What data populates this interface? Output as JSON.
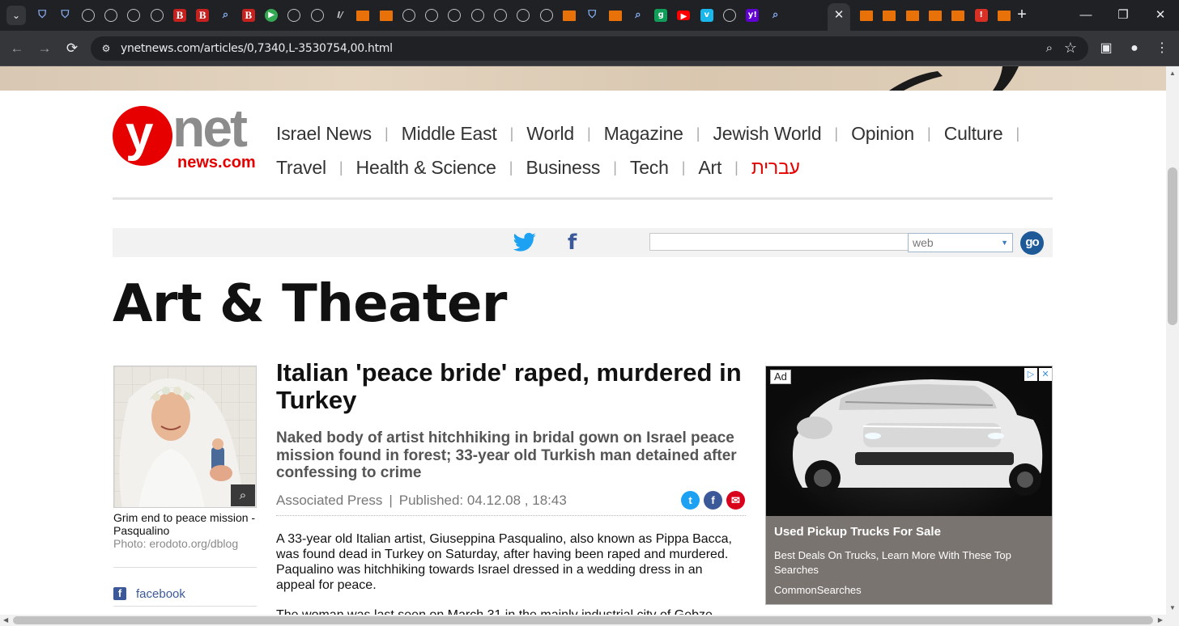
{
  "browser": {
    "url": "ynetnews.com/articles/0,7340,L-3530754,00.html",
    "tab_icons_left": [
      "shield",
      "shield",
      "globe",
      "globe",
      "globe",
      "globe",
      "b",
      "b",
      "mag",
      "b",
      "play",
      "globe",
      "globe",
      "lt",
      "flag",
      "flag",
      "globe",
      "globe",
      "globe",
      "globe",
      "globe",
      "globe",
      "globe",
      "flag",
      "shield",
      "flag",
      "mag",
      "gg",
      "yt",
      "vi",
      "globe",
      "ya",
      "mag"
    ],
    "tab_icons_right": [
      "flag",
      "flag",
      "flag",
      "flag",
      "flag",
      "red",
      "flag"
    ],
    "active_tab_close": "✕",
    "new_tab": "+",
    "buttons": {
      "back": "←",
      "forward": "→",
      "reload": "⟳"
    }
  },
  "site": {
    "logo_y": "y",
    "logo_net": "net",
    "logo_domain": "news.com",
    "nav_row1": [
      "Israel News",
      "Middle East",
      "World",
      "Magazine",
      "Jewish World",
      "Opinion",
      "Culture"
    ],
    "nav_row2": [
      "Travel",
      "Health & Science",
      "Business",
      "Tech",
      "Art"
    ],
    "nav_hebrew": "עברית",
    "search_select": "web",
    "go_label": "go"
  },
  "section_title": "Art & Theater",
  "photo": {
    "caption": "Grim end to peace mission - Pasqualino",
    "credit": "Photo: erodoto.org/dblog"
  },
  "share_left": {
    "facebook_label": "facebook"
  },
  "article": {
    "headline": "Italian 'peace bride' raped, murdered in Turkey",
    "subheadline": "Naked body of artist hitchhiking in bridal gown on Israel peace mission found in forest; 33-year old Turkish man detained after confessing to crime",
    "source": "Associated Press",
    "published_label": "Published:",
    "published_value": "04.12.08 , 18:43",
    "para1": "A 33-year old Italian artist, Giuseppina Pasqualino, also known as Pippa Bacca, was found dead in Turkey on Saturday, after having been raped and murdered. Paqualino was hitchhiking towards Israel dressed in a wedding dress in an appeal for peace.",
    "para2": "The woman was last seen on March 31 in the mainly industrial city of Gebze"
  },
  "ad": {
    "badge": "Ad",
    "title": "Used Pickup Trucks For Sale",
    "description": "Best Deals On Trucks, Learn More With These Top Searches",
    "source": "CommonSearches"
  },
  "colors": {
    "brand_red": "#e60000",
    "twitter": "#1da1f2",
    "facebook": "#3b5998",
    "email": "#d9001b"
  }
}
